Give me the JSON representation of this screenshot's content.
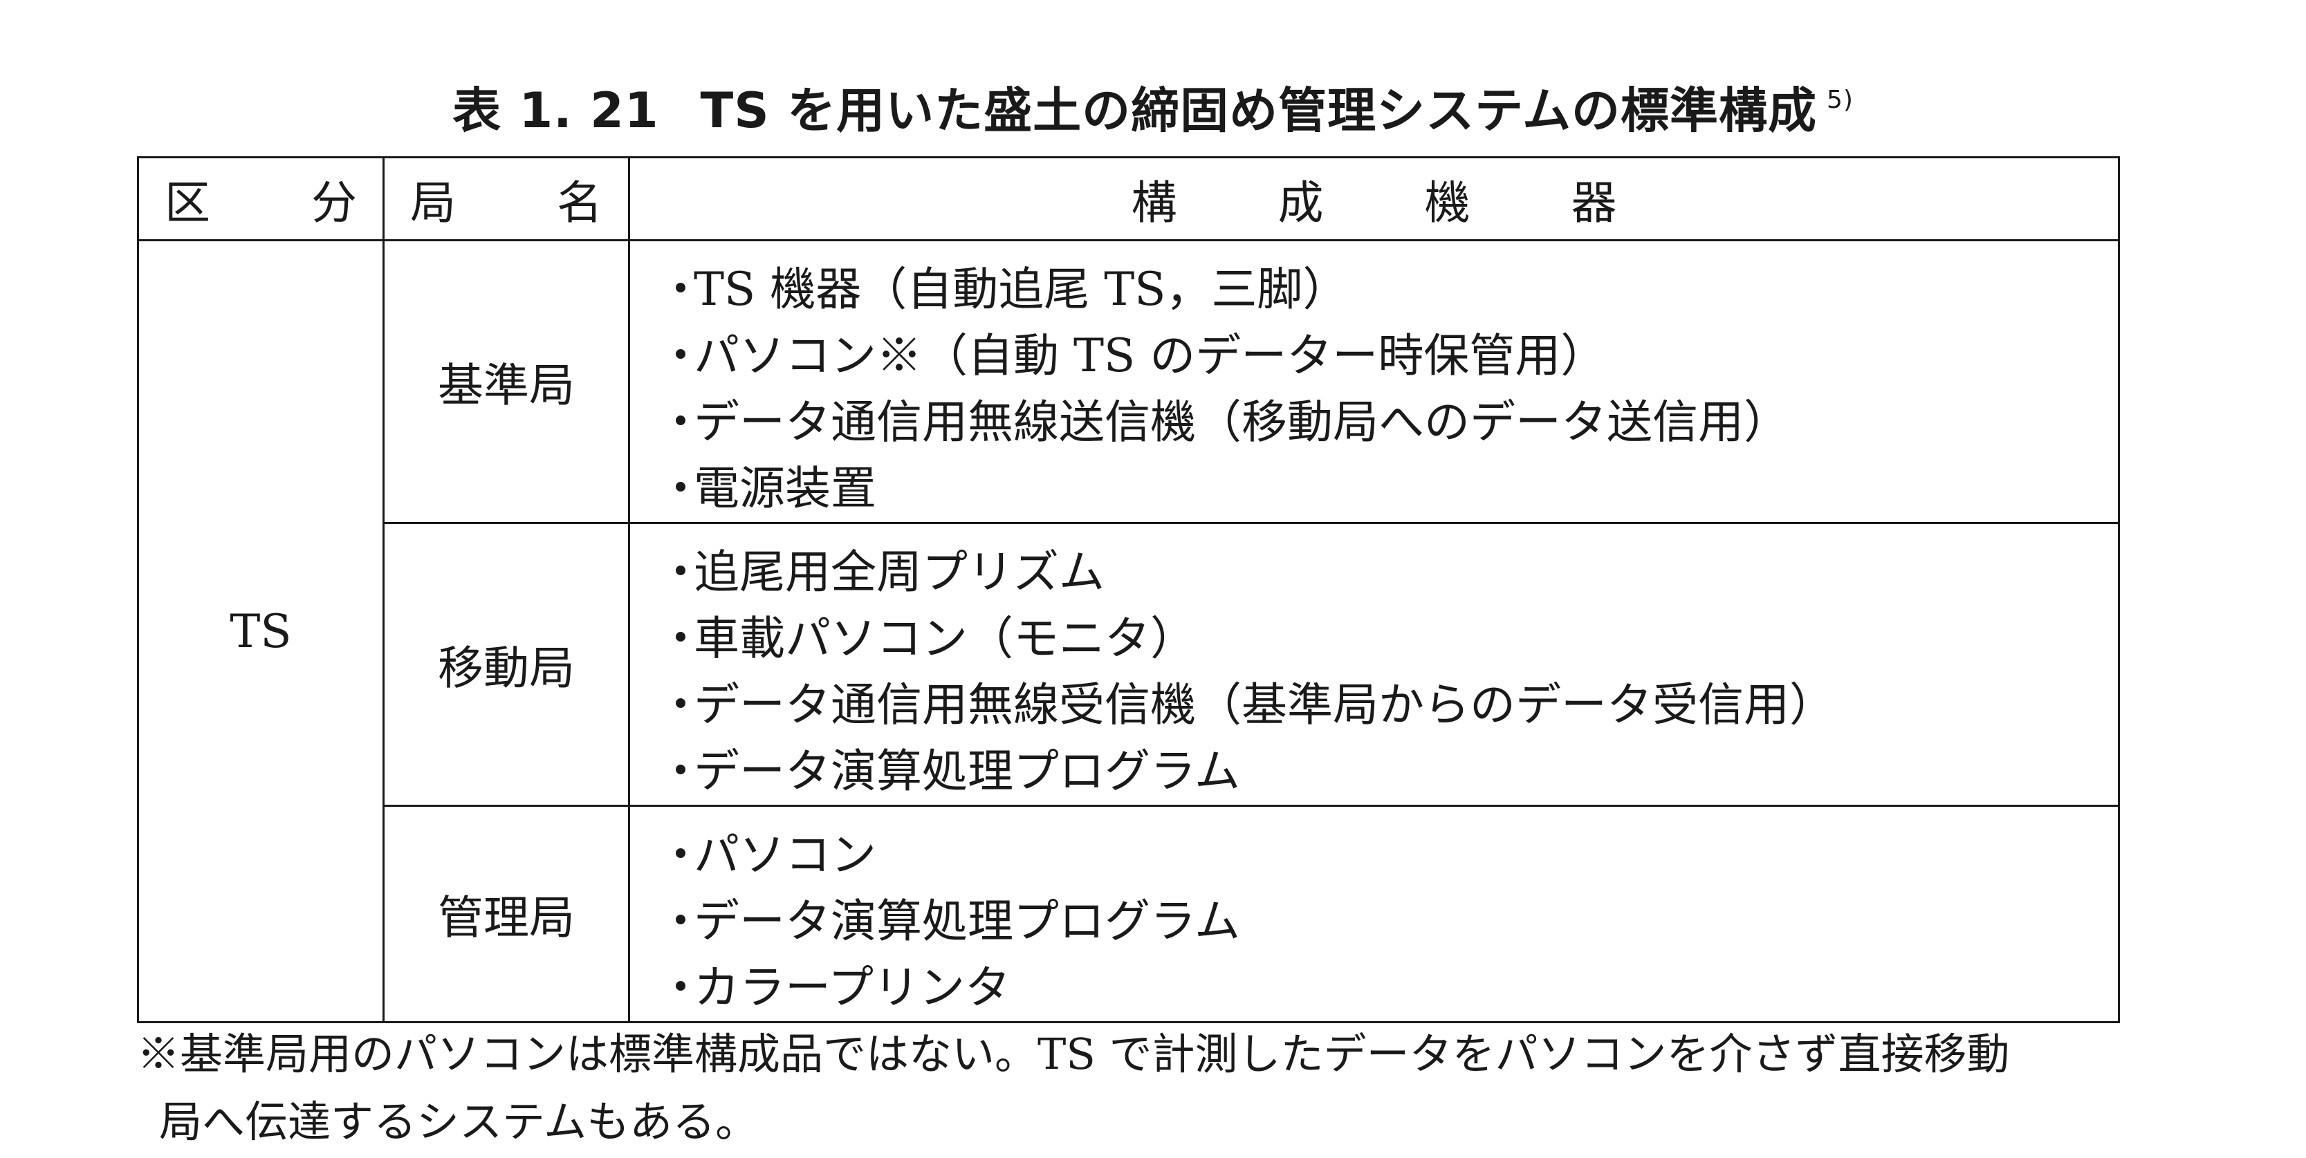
{
  "caption": {
    "number": "表 1. 21",
    "title": "TS を用いた盛土の締固め管理システムの標準構成",
    "reference": "5)"
  },
  "table": {
    "headers": [
      "区　分",
      "局　名",
      "構　成　機　器"
    ],
    "category": "TS",
    "rows": [
      {
        "station": "基準局",
        "items": [
          "TS 機器（自動追尾 TS，三脚）",
          "パソコン※（自動 TS のデーター時保管用）",
          "データ通信用無線送信機（移動局へのデータ送信用）",
          "電源装置"
        ]
      },
      {
        "station": "移動局",
        "items": [
          "追尾用全周プリズム",
          "車載パソコン（モニタ）",
          "データ通信用無線受信機（基準局からのデータ受信用）",
          "データ演算処理プログラム"
        ]
      },
      {
        "station": "管理局",
        "items": [
          "パソコン",
          "データ演算処理プログラム",
          "カラープリンタ"
        ]
      }
    ],
    "bullet": "・"
  },
  "note": {
    "line1": "※基準局用のパソコンは標準構成品ではない。TS で計測したデータをパソコンを介さず直接移動",
    "line2": "局へ伝達するシステムもある。"
  }
}
